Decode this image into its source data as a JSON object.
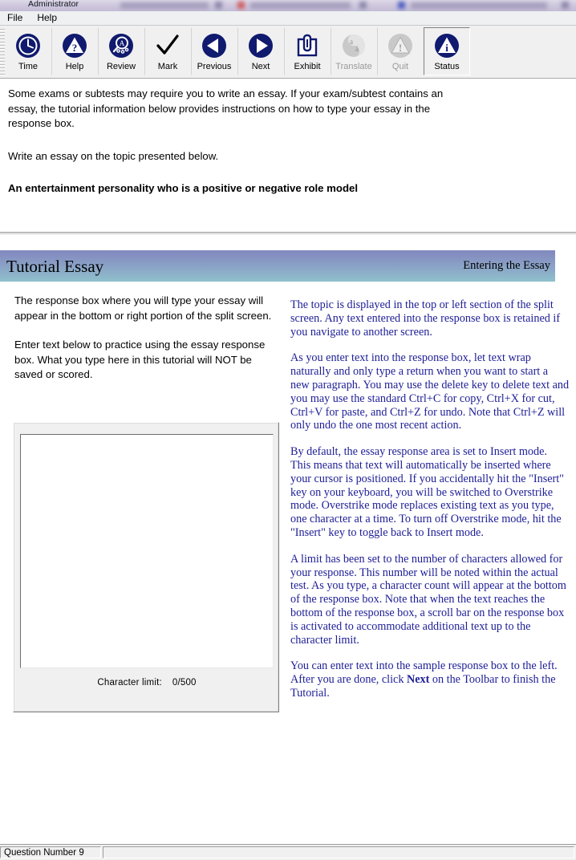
{
  "taskbar": {
    "user_label": "Administrator"
  },
  "menubar": {
    "items": [
      {
        "label": "File",
        "name": "menu-file"
      },
      {
        "label": "Help",
        "name": "menu-help"
      }
    ]
  },
  "toolbar": {
    "buttons": [
      {
        "label": "Time",
        "icon": "clock-icon",
        "disabled": false,
        "selected": false
      },
      {
        "label": "Help",
        "icon": "question-triangle-icon",
        "disabled": false,
        "selected": false
      },
      {
        "label": "Review",
        "icon": "magnifier-icon",
        "disabled": false,
        "selected": false
      },
      {
        "label": "Mark",
        "icon": "checkmark-icon",
        "disabled": false,
        "selected": false
      },
      {
        "label": "Previous",
        "icon": "left-arrow-icon",
        "disabled": false,
        "selected": false
      },
      {
        "label": "Next",
        "icon": "right-arrow-icon",
        "disabled": false,
        "selected": false
      },
      {
        "label": "Exhibit",
        "icon": "clipboard-icon",
        "disabled": false,
        "selected": false
      },
      {
        "label": "Translate",
        "icon": "translate-icon",
        "disabled": true,
        "selected": false
      },
      {
        "label": "Quit",
        "icon": "warning-triangle-icon",
        "disabled": true,
        "selected": false
      },
      {
        "label": "Status",
        "icon": "info-triangle-icon",
        "disabled": false,
        "selected": true
      }
    ]
  },
  "instructions": {
    "para1": "Some exams or subtests may require you to write an essay. If your exam/subtest contains an essay, the tutorial information below provides instructions on how to type your essay in the response box.",
    "para2": "Write an essay on the topic presented below.",
    "topic": "An entertainment personality who is a positive or negative role model"
  },
  "band": {
    "title": "Tutorial Essay",
    "subtitle": "Entering the Essay"
  },
  "left_column": {
    "para1": "The response box where you will type your essay will appear in the bottom or right portion of the split screen.",
    "para2": "Enter text below to practice using the essay response box.  What you type here in this tutorial will NOT be saved or scored."
  },
  "right_column": {
    "para1": "The topic is displayed in the top or left section of the split screen. Any text entered into the response box is retained if you navigate to another screen.",
    "para2": "As you enter text into the response box, let text wrap naturally and only type a return when you want to start a new paragraph. You may use the delete key to delete text and you may use the standard Ctrl+C for copy, Ctrl+X for cut, Ctrl+V for paste, and Ctrl+Z for undo. Note that Ctrl+Z will only undo the one most recent action.",
    "para3": "By default, the essay response area is set to Insert mode. This means that text will automatically be inserted where your cursor is positioned. If you accidentally hit the \"Insert\" key on your keyboard, you will be switched to Overstrike mode. Overstrike mode replaces existing text as you type, one character at a time. To turn off Overstrike mode, hit the \"Insert\" key to toggle back to Insert mode.",
    "para4": "A limit has been set to the number of characters allowed for your response. This number will be noted within the actual test. As you type, a character count will appear at the bottom of the response box. Note that when the text reaches the bottom of the response box, a scroll bar on the response box is activated to accommodate additional text up to the character limit.",
    "para5_a": "You can enter text into the sample response box to the left. After you are done, click ",
    "para5_bold": "Next",
    "para5_b": " on the Toolbar to finish the Tutorial."
  },
  "response_box": {
    "value": "",
    "placeholder": "",
    "char_limit_label": "Character limit:",
    "char_limit_value": "0/500"
  },
  "statusbar": {
    "question_label": "Question Number 9",
    "right_label": ""
  },
  "colors": {
    "brand_navy": "#1d1d96",
    "icon_navy": "#101a6e",
    "band_top": "#8089bd",
    "band_bottom": "#8fc1cc",
    "chrome": "#f0f0f0",
    "disabled_gray": "#9a9a9a"
  }
}
